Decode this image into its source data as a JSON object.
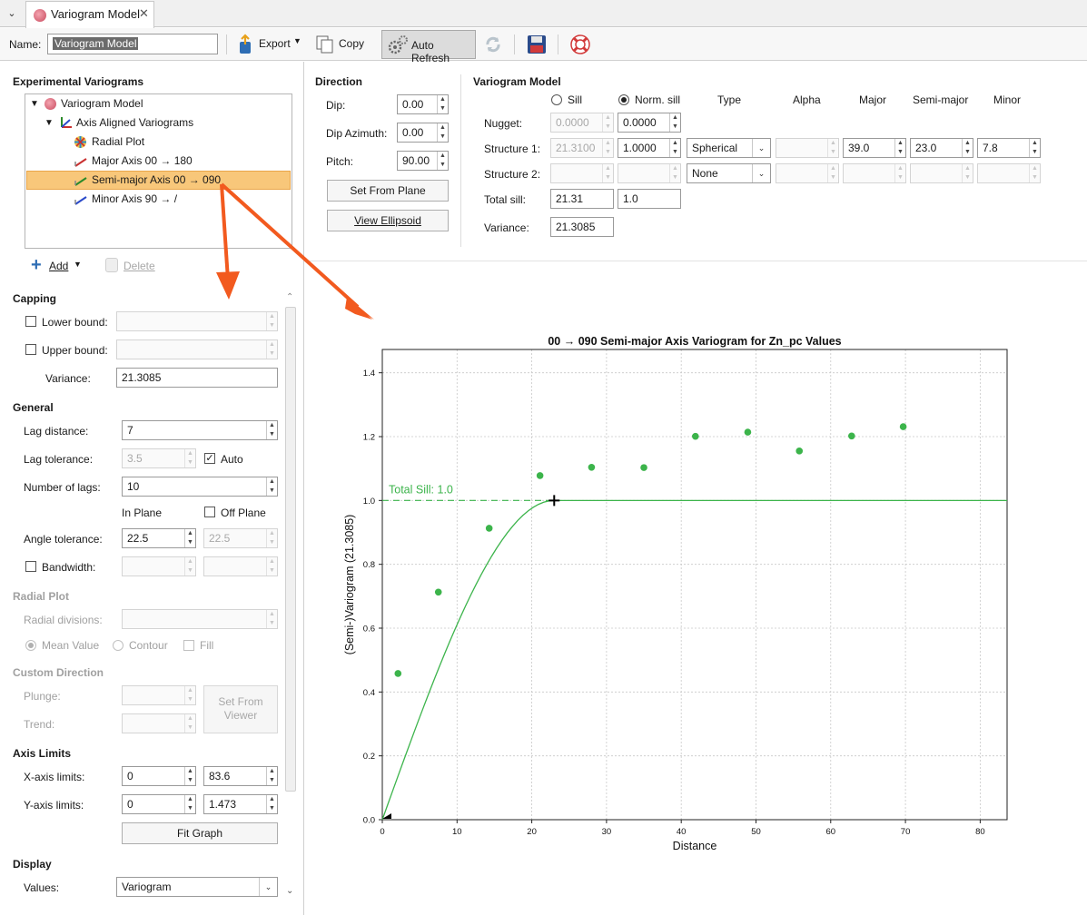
{
  "tab": {
    "title": "Variogram Model"
  },
  "toolbar": {
    "name_label": "Name:",
    "name_value": "Variogram Model",
    "export_label": "Export",
    "copy_label": "Copy",
    "auto_refresh_label": "Auto Refresh"
  },
  "experimental": {
    "title": "Experimental Variograms",
    "tree": {
      "root": "Variogram Model",
      "group": "Axis Aligned Variograms",
      "items": [
        "Radial Plot",
        "Major Axis 00 → 180",
        "Semi-major Axis 00 → 090",
        "Minor Axis 90 → /"
      ]
    },
    "add_label": "Add",
    "delete_label": "Delete"
  },
  "capping": {
    "title": "Capping",
    "lower_bound_label": "Lower bound:",
    "upper_bound_label": "Upper bound:",
    "variance_label": "Variance:",
    "variance_value": "21.3085"
  },
  "general": {
    "title": "General",
    "lag_distance_label": "Lag distance:",
    "lag_distance_value": "7",
    "lag_tolerance_label": "Lag tolerance:",
    "lag_tolerance_value": "3.5",
    "auto_label": "Auto",
    "number_of_lags_label": "Number of lags:",
    "number_of_lags_value": "10",
    "in_plane_label": "In Plane",
    "off_plane_label": "Off Plane",
    "angle_tolerance_label": "Angle tolerance:",
    "angle_tolerance_value": "22.5",
    "angle_tolerance_off_value": "22.5",
    "bandwidth_label": "Bandwidth:"
  },
  "radial_plot": {
    "title": "Radial Plot",
    "radial_divisions_label": "Radial divisions:",
    "mean_value_label": "Mean Value",
    "contour_label": "Contour",
    "fill_label": "Fill"
  },
  "custom_direction": {
    "title": "Custom Direction",
    "plunge_label": "Plunge:",
    "trend_label": "Trend:",
    "set_from_viewer_label": "Set From Viewer"
  },
  "axis_limits": {
    "title": "Axis Limits",
    "x_label": "X-axis limits:",
    "x_min": "0",
    "x_max": "83.6",
    "y_label": "Y-axis limits:",
    "y_min": "0",
    "y_max": "1.473",
    "fit_graph_label": "Fit Graph"
  },
  "display": {
    "title": "Display",
    "values_label": "Values:",
    "values_value": "Variogram"
  },
  "direction": {
    "title": "Direction",
    "dip_label": "Dip:",
    "dip_value": "0.00",
    "dip_azimuth_label": "Dip Azimuth:",
    "dip_azimuth_value": "0.00",
    "pitch_label": "Pitch:",
    "pitch_value": "90.00",
    "set_from_plane_label": "Set From Plane",
    "view_ellipsoid_label": "View Ellipsoid"
  },
  "variogram_model": {
    "title": "Variogram Model",
    "sill_label": "Sill",
    "norm_sill_label": "Norm. sill",
    "col_type": "Type",
    "col_alpha": "Alpha",
    "col_major": "Major",
    "col_semi_major": "Semi-major",
    "col_minor": "Minor",
    "nugget_label": "Nugget:",
    "nugget_sill": "0.0000",
    "nugget_norm": "0.0000",
    "structure1_label": "Structure 1:",
    "s1_sill": "21.3100",
    "s1_norm": "1.0000",
    "s1_type": "Spherical",
    "s1_major": "39.0",
    "s1_semi_major": "23.0",
    "s1_minor": "7.8",
    "structure2_label": "Structure 2:",
    "s2_type": "None",
    "total_sill_label": "Total sill:",
    "total_sill_value": "21.31",
    "total_sill_norm": "1.0",
    "variance_label": "Variance:",
    "variance_value": "21.3085"
  },
  "chart_data": {
    "type": "scatter",
    "title": "00 → 090 Semi-major Axis Variogram for Zn_pc Values",
    "xlabel": "Distance",
    "ylabel": "(Semi-)Variogram (21.3085)",
    "xlim": [
      0,
      83.6
    ],
    "ylim": [
      0,
      1.473
    ],
    "x_ticks": [
      0,
      10,
      20,
      30,
      40,
      50,
      60,
      70,
      80
    ],
    "y_ticks": [
      0.0,
      0.2,
      0.4,
      0.6,
      0.8,
      1.0,
      1.2,
      1.4
    ],
    "grid": true,
    "series": [
      {
        "x": [
          2.1,
          7.5,
          14.3,
          21.1,
          28.0,
          35.0,
          41.9,
          48.9,
          55.8,
          62.8,
          69.7
        ],
        "y": [
          0.458,
          0.713,
          0.913,
          1.078,
          1.104,
          1.103,
          1.201,
          1.214,
          1.155,
          1.202,
          1.231
        ],
        "color": "#3cb44b"
      }
    ],
    "model": {
      "type": "spherical",
      "range": 23.0,
      "sill": 1.0,
      "nugget": 0.0,
      "color": "#3cb44b"
    },
    "total_sill_label": "Total Sill: 1.0",
    "total_sill_value": 1.0
  }
}
